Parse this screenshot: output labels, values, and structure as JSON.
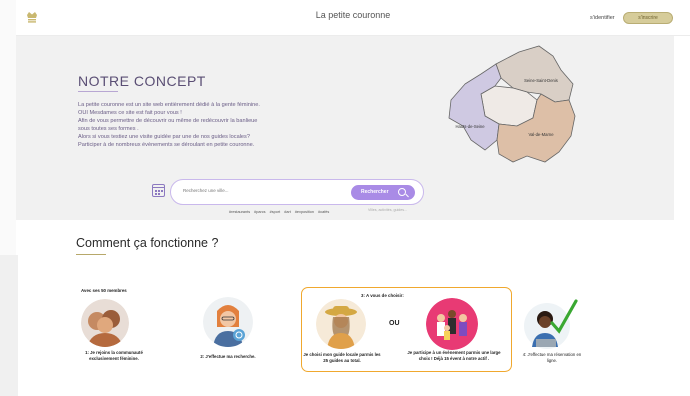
{
  "header": {
    "brand": "La petite couronne",
    "login": "s'identifier",
    "signup": "s'inscrire",
    "logo_icon": "crown-icon"
  },
  "concept": {
    "title": "NOTRE CONCEPT",
    "lines": [
      "La petite couronne est un site web entièrement dédié à la gente féminine.",
      "OUI Mesdames ce site est fait pour vous !",
      "Afin de vous permettre de découvrir ou même de redécouvrir la banlieue",
      "sous toutes ses formes .",
      "Alors si vous testiez une visite guidée par une de nos guides locales?",
      "Participer à de nombreux évènements  se déroulant en petite couronne."
    ],
    "map": {
      "north": "Seine-Saint-Denis",
      "west": "Hauts-de-Seine",
      "southeast": "Val-de-Marne"
    }
  },
  "search": {
    "placeholder": "Recherchez une ville...",
    "button_label": "Rechercher",
    "tags": "#restaurants  #parcs  #sport  #art  #exposition  #cafés",
    "sublabel": "Villes, activités, guides..."
  },
  "how": {
    "title": "Comment ça fonctionne ?",
    "members": "Avec ses 50 membres",
    "step1": "1: Je rejoins la communauté exclusivement féminine.",
    "step2": "2: J'effectue ma recherche.",
    "choice_title": "3: A vous de choisir:",
    "or_label": "OU",
    "choice_a": "Je choisi mon guide locale parmis les 25 guides au total.",
    "choice_b": "Je participe à un évènement parmis une large choix ! Déjà 15 évent à notre actif .",
    "step4": "4: J'effectue ma réservation en ligne."
  },
  "colors": {
    "accent_purple": "#a98be6",
    "gold": "#d6cc9a",
    "orange_border": "#f0a82e",
    "check_green": "#3aa832"
  }
}
